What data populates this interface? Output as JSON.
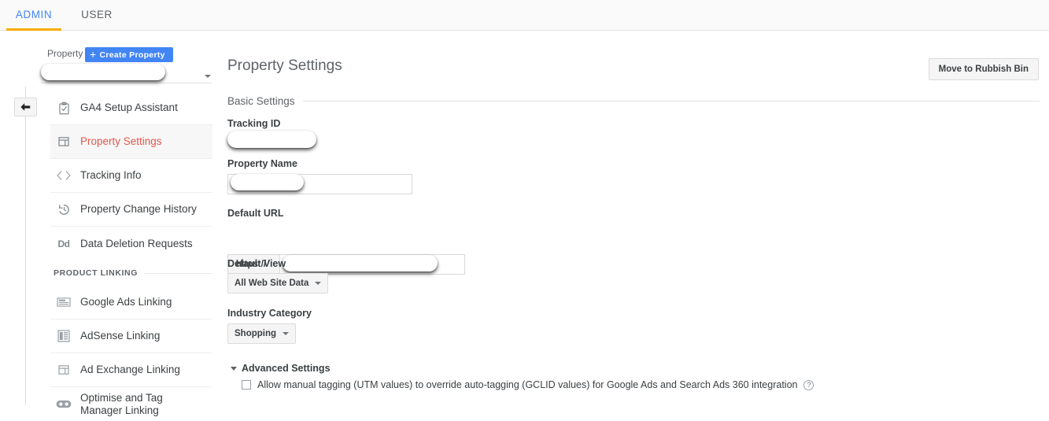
{
  "tabs": [
    {
      "label": "ADMIN",
      "active": true
    },
    {
      "label": "USER",
      "active": false
    }
  ],
  "colors": {
    "tab_active": "#4285f4",
    "tab_underline": "#f9ab00",
    "nav_active_text": "#e2584d",
    "primary_button": "#4285f4"
  },
  "property_header": {
    "label": "Property",
    "create_button": "Create Property",
    "selector_value": ""
  },
  "collapse_button": {
    "icon": "back-arrow-icon"
  },
  "sidebar": {
    "items": [
      {
        "label": "GA4 Setup Assistant",
        "icon": "clipboard-check-icon",
        "active": false
      },
      {
        "label": "Property Settings",
        "icon": "property-layout-icon",
        "active": true
      },
      {
        "label": "Tracking Info",
        "icon": "code-brackets-icon",
        "active": false
      },
      {
        "label": "Property Change History",
        "icon": "history-clock-icon",
        "active": false
      },
      {
        "label": "Data Deletion Requests",
        "icon": "dd-text-icon",
        "active": false
      }
    ],
    "section_label": "PRODUCT LINKING",
    "linking_items": [
      {
        "label": "Google Ads Linking",
        "icon": "ads-card-icon",
        "active": false
      },
      {
        "label": "AdSense Linking",
        "icon": "adsense-panel-icon",
        "active": false
      },
      {
        "label": "Ad Exchange Linking",
        "icon": "ad-exchange-layout-icon",
        "active": false
      },
      {
        "label": "Optimise and Tag Manager Linking",
        "icon": "tag-manager-icon",
        "active": false
      }
    ]
  },
  "main": {
    "title": "Property Settings",
    "rubbish_button": "Move to Rubbish Bin",
    "section_basic": "Basic Settings",
    "fields": {
      "tracking_id_label": "Tracking ID",
      "tracking_id_value": "",
      "property_name_label": "Property Name",
      "property_name_value": "",
      "default_url_label": "Default URL",
      "default_url_protocol": "https://",
      "default_url_value": "",
      "default_view_label": "Default View",
      "default_view_value": "All Web Site Data",
      "industry_category_label": "Industry Category",
      "industry_category_value": "Shopping"
    },
    "advanced": {
      "toggle_label": "Advanced Settings",
      "checkbox_label": "Allow manual tagging (UTM values) to override auto-tagging (GCLID values) for Google Ads and Search Ads 360 integration",
      "checkbox_checked": false,
      "help_icon": "?"
    }
  }
}
